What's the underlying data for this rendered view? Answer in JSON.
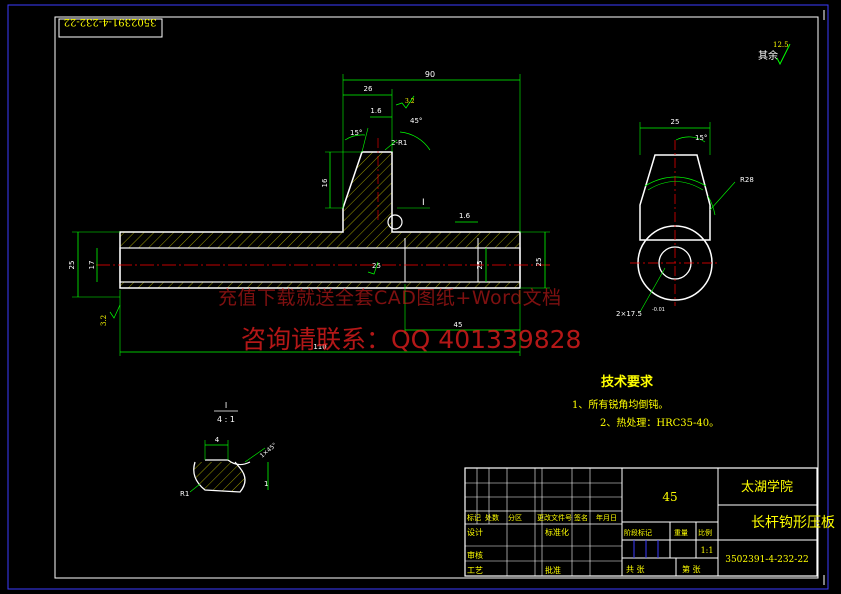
{
  "drawing": {
    "mirrored_code": "3502391-4-232-22",
    "surface_finish_label": "其余",
    "surface_finish_value": "12.5"
  },
  "main_view": {
    "dims": {
      "overall_length": "90",
      "step_length": "26",
      "groove_width": "1.6",
      "chamfer_angle": "45°",
      "taper_angle": "15°",
      "step_height": "16",
      "right_slot": "1.6",
      "left_height": "25",
      "left_bore": "17",
      "right_height": "25",
      "bore_depth_a": "25",
      "bore_depth_b": "25",
      "bottom_total": "110",
      "bottom_inner": "45",
      "roughness_left": "3.2",
      "roughness_top": "3.2",
      "hole_label": "2-R1",
      "detail_marker": "I"
    }
  },
  "side_view": {
    "dims": {
      "width": "25",
      "angle": "15°",
      "radius": "R28",
      "hole": "2×17.5",
      "hole_tol": "-0.01"
    }
  },
  "detail_view": {
    "label": "I",
    "scale": "4 : 1",
    "width_dim": "4",
    "chamfer": "1×45°",
    "radius": "R1",
    "height": "1"
  },
  "tech_requirements": {
    "title": "技术要求",
    "items": [
      "1、所有锐角均倒钝。",
      "2、热处理：HRC35-40。"
    ]
  },
  "title_block": {
    "material": "45",
    "school": "太湖学院",
    "part_name": "长杆钩形压板",
    "row_labels": [
      "标记",
      "处数",
      "分区",
      "更改文件号",
      "签名",
      "年月日"
    ],
    "designer": "设计",
    "standardize": "标准化",
    "stage_labels": [
      "阶段标记",
      "重量",
      "比例"
    ],
    "scale": "1:1",
    "reviewer": "审核",
    "process": "工艺",
    "approve": "批准",
    "sheets": "共  张",
    "sheet_no": "第  张",
    "drawing_no": "3502391-4-232-22"
  },
  "watermark": {
    "line1": "充值下载就送全套CAD图纸+Word文档",
    "line2": "咨询请联系：QQ 401339828"
  },
  "colors": {
    "background": "#000000",
    "outline": "#ffffff",
    "dimension": "#00ff00",
    "centerline": "#ff0000",
    "text": "#ffff00",
    "frame": "#3b3bff",
    "watermark": "#e61e1e"
  }
}
